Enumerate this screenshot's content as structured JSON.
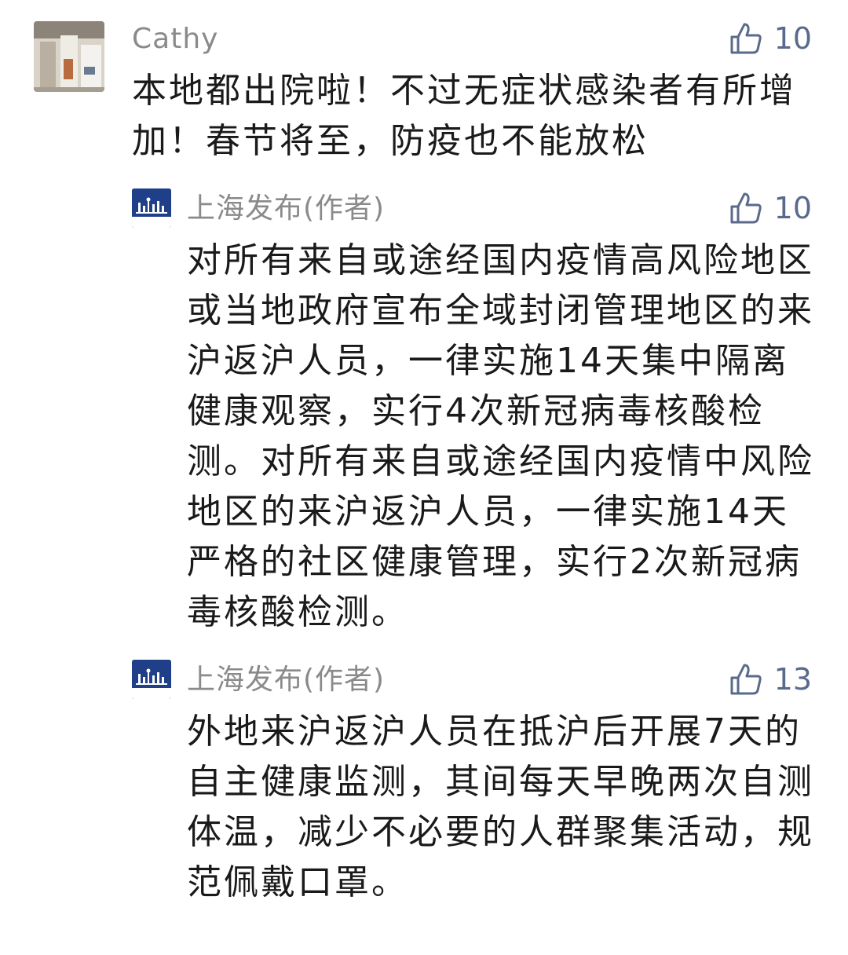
{
  "comments": [
    {
      "author": "Cathy",
      "likes": "10",
      "text": "本地都出院啦！不过无症状感染者有所增加！春节将至，防疫也不能放松"
    }
  ],
  "replies": [
    {
      "author": "上海发布(作者)",
      "avatar_label": "上海发布",
      "likes": "10",
      "text": "对所有来自或途经国内疫情高风险地区或当地政府宣布全域封闭管理地区的来沪返沪人员，一律实施14天集中隔离健康观察，实行4次新冠病毒核酸检测。对所有来自或途经国内疫情中风险地区的来沪返沪人员，一律实施14天严格的社区健康管理，实行2次新冠病毒核酸检测。"
    },
    {
      "author": "上海发布(作者)",
      "avatar_label": "上海发布",
      "likes": "13",
      "text": "外地来沪返沪人员在抵沪后开展7天的自主健康监测，其间每天早晚两次自测体温，减少不必要的人群聚集活动，规范佩戴口罩。"
    }
  ],
  "icons": {
    "like": "thumbs-up-icon"
  },
  "colors": {
    "like": "#5a6a8c",
    "author": "#8a8a8a",
    "text": "#1a1a1a",
    "brand": "#1f3f88"
  }
}
